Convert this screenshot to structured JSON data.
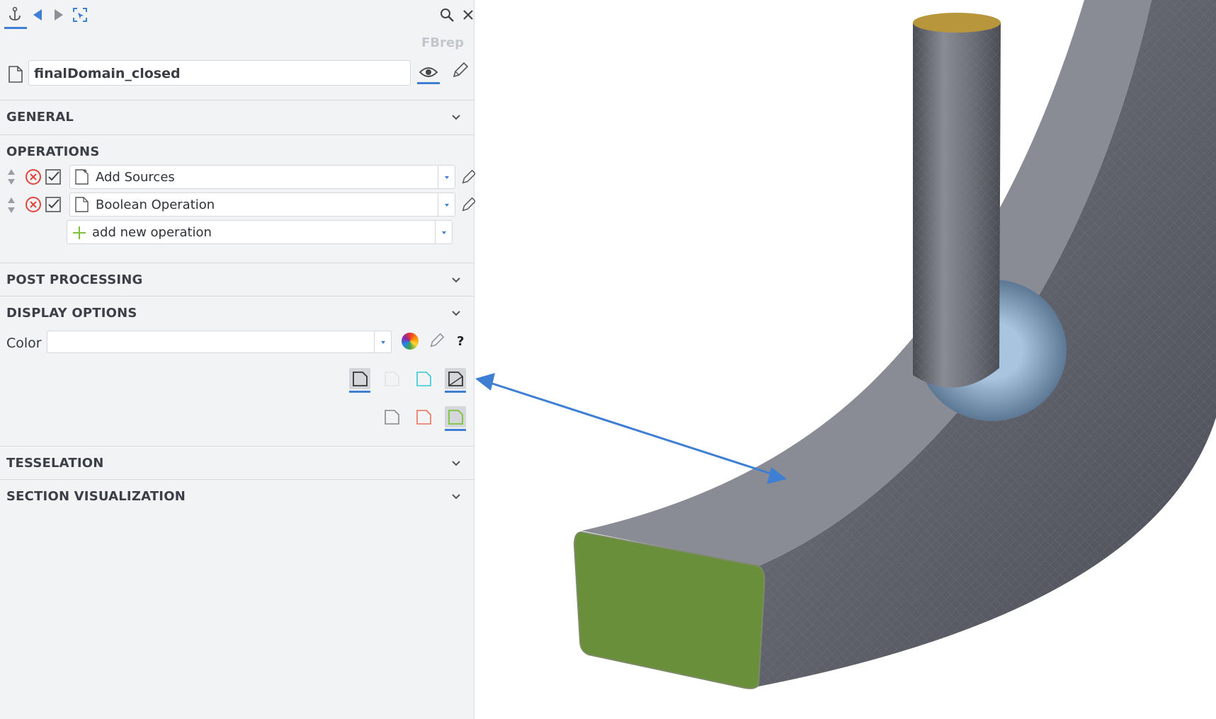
{
  "panel": {
    "type_badge": "FBrep",
    "object_name": "finalDomain_closed",
    "sections": {
      "general": "GENERAL",
      "operations": "OPERATIONS",
      "post_processing": "POST PROCESSING",
      "display_options": "DISPLAY OPTIONS",
      "tesselation": "TESSELATION",
      "section_visualization": "SECTION VISUALIZATION"
    },
    "operations": [
      {
        "label": "Add Sources",
        "enabled": true
      },
      {
        "label": "Boolean Operation",
        "enabled": true
      }
    ],
    "add_operation_label": "add new operation",
    "display": {
      "color_label": "Color",
      "color_value": "",
      "help_label": "?"
    }
  },
  "icons": [
    "anchor-icon",
    "back-arrow-icon",
    "forward-arrow-icon",
    "select-icon",
    "search-icon",
    "close-icon",
    "file-icon",
    "eye-icon",
    "pencil-icon",
    "chevron-down-icon",
    "sort-arrows-icon",
    "remove-icon",
    "checkbox-icon",
    "plus-icon",
    "color-wheel-icon",
    "help-icon"
  ],
  "colors": {
    "accent": "#3f7fd3",
    "panel_bg": "#f2f3f5",
    "remove_red": "#e0453a",
    "plus_green": "#7cc33a",
    "mesh_gray": "#62646e",
    "face_green": "#6a8f3b"
  }
}
